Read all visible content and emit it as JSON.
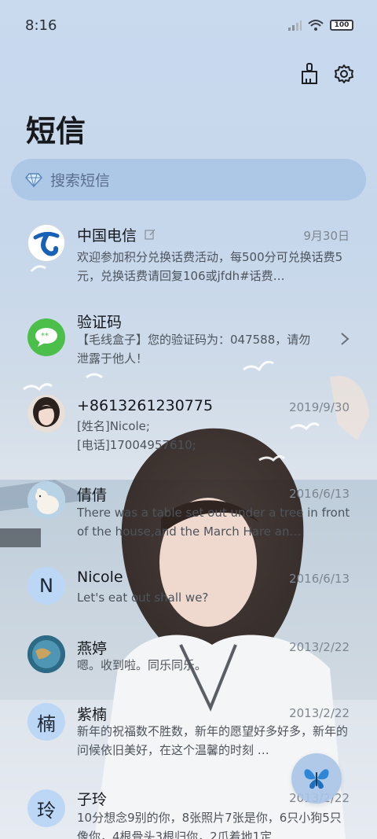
{
  "status_bar": {
    "time": "8:16",
    "battery": "100"
  },
  "header": {
    "title": "短信"
  },
  "search": {
    "placeholder": "搜索短信"
  },
  "conversations": [
    {
      "name": "中国电信",
      "date": "9月30日",
      "preview": "欢迎参加积分兑换话费活动，每500分可兑换话费5元，兑换话费请回复106或jfdh#话费…"
    },
    {
      "name": "验证码",
      "date": "",
      "preview": "【毛线盒子】您的验证码为：047588，请勿泄露于他人！"
    },
    {
      "name": "+8613261230775",
      "date": "2019/9/30",
      "preview_lines": [
        "[姓名]Nicole;",
        "[电话]17004957610;"
      ]
    },
    {
      "name": "倩倩",
      "date": "2016/6/13",
      "preview": "There was a table set out under a tree in front of the house,and the March Hare an…"
    },
    {
      "name": "Nicole",
      "date": "2016/6/13",
      "preview": "Let's eat out shall we?",
      "avatar_letter": "N"
    },
    {
      "name": "燕婷",
      "date": "2013/2/22",
      "preview": "嗯。收到啦。同乐同乐。"
    },
    {
      "name": "紫楠",
      "date": "2013/2/22",
      "preview": "新年的祝福数不胜数，新年的愿望好多好多，新年的问候依旧美好，在这个温馨的时刻 …",
      "avatar_letter": "楠"
    },
    {
      "name": "子玲",
      "date": "2013/2/22",
      "preview": "10分想念9别的你，8张照片7张是你，6只小狗5只像你，4根骨头3根归你，2爪着地1定",
      "avatar_letter": "玲"
    }
  ],
  "colors": {
    "accent": "#bcd7f5",
    "search_bg": "#a4c0e4"
  }
}
